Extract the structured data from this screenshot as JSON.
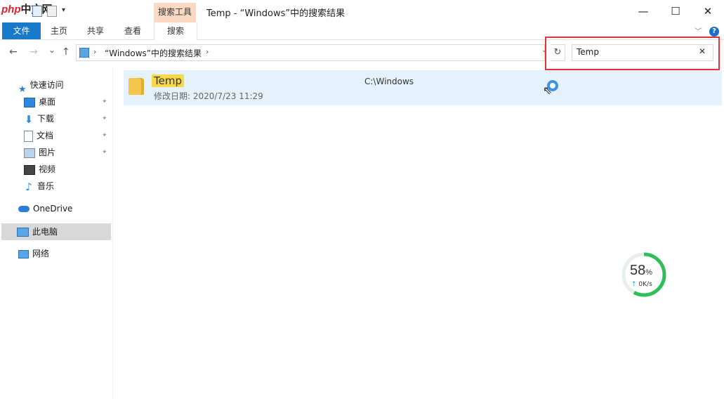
{
  "watermark": {
    "brand_a": "php",
    "brand_b": "中文网"
  },
  "title_bar": {
    "tool_tab": "搜索工具",
    "title": "Temp - “Windows”中的搜索结果",
    "minimize": "—",
    "maximize": "☐",
    "close": "✕"
  },
  "ribbon": {
    "tabs": [
      "文件",
      "主页",
      "共享",
      "查看",
      "搜索"
    ],
    "active_tab": "搜索",
    "expand_glyph": "﹀",
    "help_glyph": "?"
  },
  "nav": {
    "back": "←",
    "forward": "→",
    "recent": "⌄",
    "up": "↑",
    "address_path": "“Windows”中的搜索结果",
    "sep": "›",
    "dropdown": "⌄",
    "refresh": "↻"
  },
  "search": {
    "value": "Temp",
    "clear_glyph": "✕"
  },
  "sidebar": {
    "quick_access": "快速访问",
    "quick_items": [
      {
        "label": "桌面",
        "icon": "desktop-icon",
        "pinned": true
      },
      {
        "label": "下载",
        "icon": "download-icon",
        "pinned": true
      },
      {
        "label": "文档",
        "icon": "document-icon",
        "pinned": true
      },
      {
        "label": "图片",
        "icon": "picture-icon",
        "pinned": true
      },
      {
        "label": "视频",
        "icon": "video-icon",
        "pinned": false
      },
      {
        "label": "音乐",
        "icon": "music-icon",
        "pinned": false
      }
    ],
    "onedrive": "OneDrive",
    "this_pc": "此电脑",
    "network": "网络",
    "pin_glyph": "📌"
  },
  "results": [
    {
      "name": "Temp",
      "meta": "修改日期: 2020/7/23 11:29",
      "path": "C:\\Windows"
    }
  ],
  "gauge": {
    "percent": 58,
    "percent_sign": "%",
    "speed": "0K/s",
    "arrow": "↑"
  },
  "colors": {
    "accent": "#1979ca",
    "selection": "#e5f1fb",
    "highlight_box": "#e2333c",
    "gauge_green": "#2fbf5a"
  }
}
